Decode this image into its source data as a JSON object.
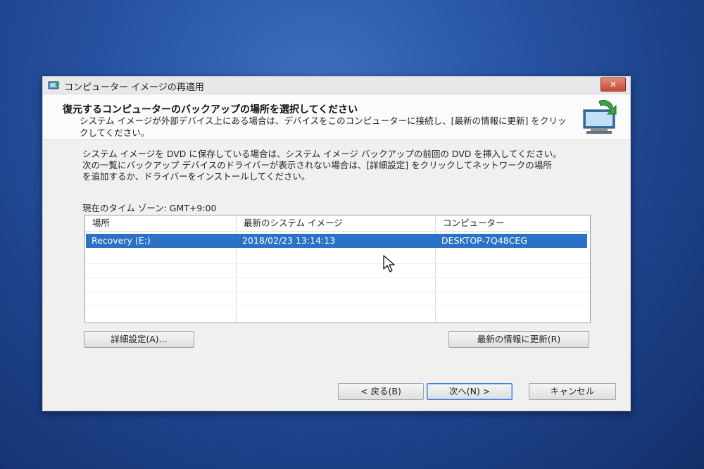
{
  "window": {
    "title": "コンピューター イメージの再適用",
    "close_label": "✕"
  },
  "header": {
    "title": "復元するコンピューターのバックアップの場所を選択してください",
    "subtitle": "システム イメージが外部デバイス上にある場合は、デバイスをこのコンピューターに接続し、[最新の情報に更新] をクリックしてください。"
  },
  "instructions": {
    "line1": "システム イメージを DVD に保存している場合は、システム イメージ バックアップの前回の DVD を挿入してください。",
    "line2": "次の一覧にバックアップ デバイスのドライバーが表示されない場合は、[詳細設定] をクリックしてネットワークの場所",
    "line3": "を追加するか、ドライバーをインストールしてください。"
  },
  "timezone_label": "現在のタイム ゾーン: GMT+9:00",
  "table": {
    "columns": [
      "場所",
      "最新のシステム イメージ",
      "コンピューター"
    ],
    "rows": [
      {
        "location": "Recovery (E:)",
        "latest_image": "2018/02/23 13:14:13",
        "computer": "DESKTOP-7Q48CEG",
        "selected": true
      }
    ]
  },
  "buttons": {
    "advanced": "詳細設定(A)...",
    "refresh": "最新の情報に更新(R)",
    "back": "< 戻る(B)",
    "next": "次へ(N) >",
    "cancel": "キャンセル"
  },
  "colors": {
    "selection": "#2b72c6",
    "desktop": "#2855a6",
    "close_button": "#c64a36"
  },
  "icons": [
    "restore-window-icon",
    "computer-restore-icon",
    "close-icon",
    "mouse-cursor-icon"
  ]
}
